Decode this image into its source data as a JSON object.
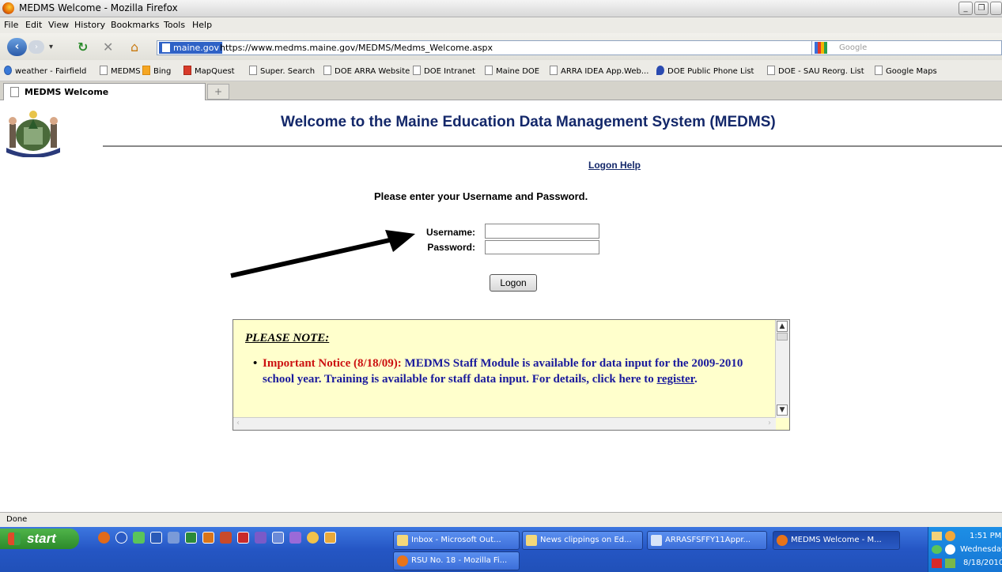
{
  "window": {
    "title": "MEDMS Welcome - Mozilla Firefox"
  },
  "menu": [
    "File",
    "Edit",
    "View",
    "History",
    "Bookmarks",
    "Tools",
    "Help"
  ],
  "nav": {
    "site_badge": "maine.gov",
    "url": "https://www.medms.maine.gov/MEDMS/Medms_Welcome.aspx",
    "search_placeholder": "Google"
  },
  "bookmarks": [
    "weather - Fairfield",
    "MEDMS",
    "Bing",
    "MapQuest",
    "Super. Search",
    "DOE ARRA Website",
    "DOE Intranet",
    "Maine DOE",
    "ARRA IDEA App.Web...",
    "DOE Public Phone List",
    "DOE - SAU Reorg. List",
    "Google Maps"
  ],
  "tab": {
    "label": "MEDMS Welcome",
    "new_tab": "+"
  },
  "page": {
    "heading": "Welcome to the Maine Education Data Management System (MEDMS)",
    "logon_help": "Logon Help",
    "prompt": "Please enter your Username and Password.",
    "username_label": "Username:",
    "password_label": "Password:",
    "username_value": "",
    "password_value": "",
    "logon_button": "Logon",
    "notice": {
      "heading": "PLEASE NOTE:",
      "bullet": "•",
      "important": "Important Notice (8/18/09):",
      "text": " MEDMS Staff Module is available for data input for the 2009-2010 school year. Training is available for staff data input.  For details, click here to ",
      "link": "register",
      "end": "."
    }
  },
  "status": "Done",
  "taskbar": {
    "start": "start",
    "tasks": [
      "Inbox - Microsoft Out...",
      "News clippings on Ed...",
      "ARRASFSFFY11Appr...",
      "MEDMS Welcome - M...",
      "RSU No. 18 - Mozilla Fi..."
    ],
    "time": "1:51 PM",
    "day": "Wednesday",
    "date": "8/18/2010"
  },
  "colors": {
    "heading": "#14286a",
    "notice_bg": "#ffffcc",
    "important": "#cc1111",
    "notice_text": "#1a1a9c"
  }
}
